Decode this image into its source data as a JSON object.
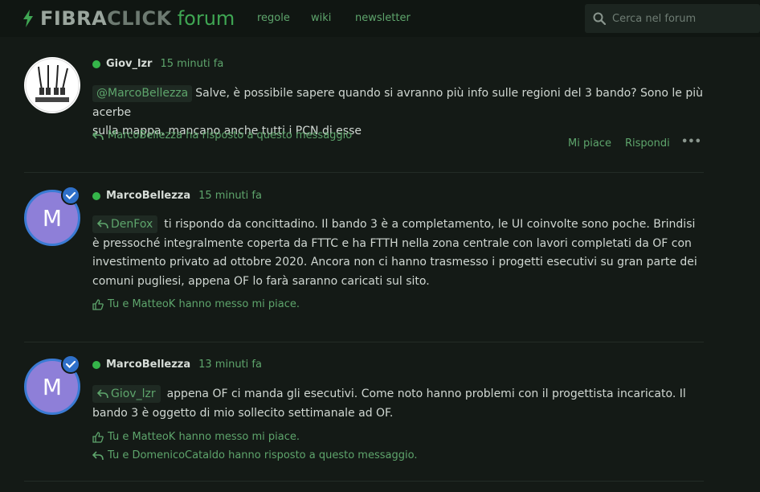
{
  "header": {
    "logo_part1": "FIBRA",
    "logo_part2": "CLICK",
    "logo_part3": "forum",
    "nav": [
      "regole",
      "wiki",
      "newsletter"
    ],
    "search_placeholder": "Cerca nel forum"
  },
  "posts": [
    {
      "username": "Giov_lzr",
      "time": "15 minuti fa",
      "mention": "@MarcoBellezza",
      "text_line1": "Salve, è possibile sapere quando si avranno più info sulle regioni del 3 bando? Sono le più acerbe",
      "text_line2": "sulla mappa, mancano anche tutti i PCN di esse",
      "reply_info": "MarcoBellezza ha risposto a questo messaggio",
      "like_label": "Mi piace",
      "reply_label": "Rispondi",
      "more_label": "•••"
    },
    {
      "username": "MarcoBellezza",
      "avatar_letter": "M",
      "time": "15 minuti fa",
      "quote_user": "DenFox",
      "text": "ti rispondo da concittadino. Il bando 3 è a completamento, le UI coinvolte sono poche. Brindisi è pressoché integralmente coperta da FTTC e ha FTTH nella zona centrale con lavori completati da OF con investimento privato ad ottobre 2020. Ancora non ci hanno trasmesso i progetti esecutivi su gran parte dei comuni pugliesi, appena OF lo farà saranno caricati sul sito.",
      "likes_info": "Tu e MatteoK hanno messo mi piace."
    },
    {
      "username": "MarcoBellezza",
      "avatar_letter": "M",
      "time": "13 minuti fa",
      "quote_user": "Giov_lzr",
      "text": "appena OF ci manda gli esecutivi. Come noto hanno problemi con il progettista incaricato. Il bando 3 è oggetto di mio sollecito settimanale ad OF.",
      "likes_info": "Tu e MatteoK hanno messo mi piace.",
      "reply_info": "Tu e DomenicoCataldo hanno risposto a questo messaggio."
    }
  ],
  "colors": {
    "background": "#141a16",
    "header": "#101612",
    "accent": "#5ea56c",
    "online": "#35b54a",
    "avatar": "#8e7fd8",
    "verified": "#2f70c9"
  }
}
